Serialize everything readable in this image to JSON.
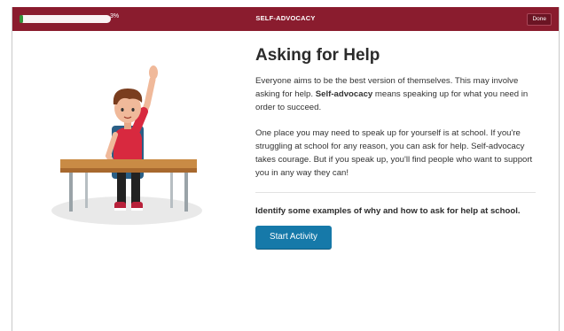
{
  "header": {
    "title": "SELF-ADVOCACY",
    "progress_percent": 3,
    "progress_label": "3%",
    "done_label": "Done"
  },
  "main": {
    "heading": "Asking for Help",
    "para1_before": "Everyone aims to be the best version of themselves. This may involve asking for help. ",
    "para1_bold": "Self-advocacy",
    "para1_after": " means speaking up for what you need in order to succeed.",
    "para2": "One place you may need to speak up for yourself is at school. If you're struggling at school for any reason, you can ask for help. Self-advocacy takes courage. But if you speak up, you'll find people who want to support you in any way they can!",
    "prompt": "Identify some examples of why and how to ask for help at school.",
    "start_label": "Start Activity"
  },
  "colors": {
    "header_bg": "#8a1c2e",
    "progress_fill": "#2e9a3a",
    "button_blue": "#1679a9"
  }
}
